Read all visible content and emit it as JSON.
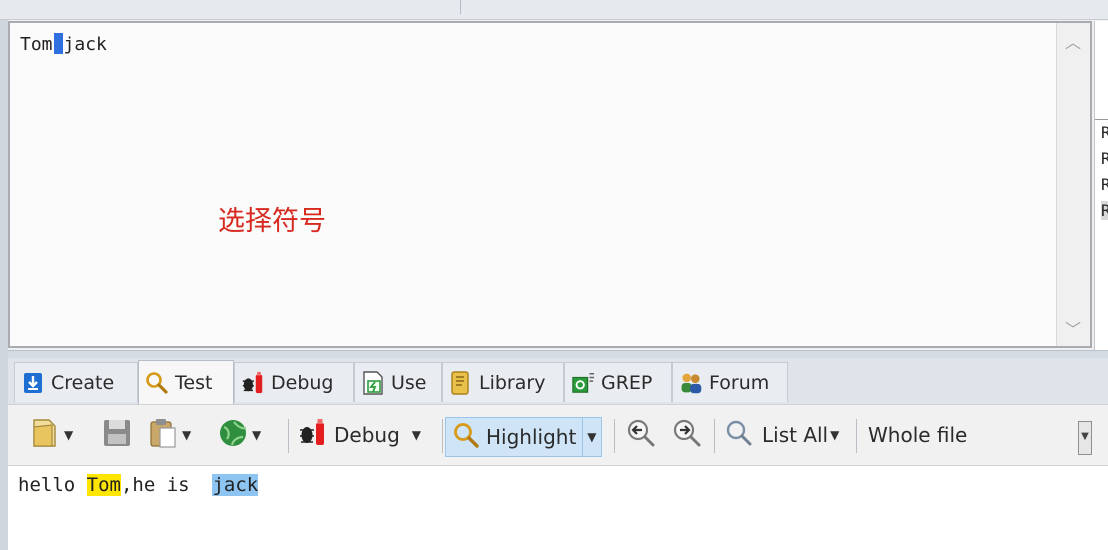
{
  "editor": {
    "regex_before": "Tom",
    "regex_after": "jack",
    "annotation": "选择符号",
    "scroll_up": "︿",
    "scroll_down": "﹀"
  },
  "right_panel": {
    "rows": [
      "R",
      "R",
      "R",
      "R"
    ]
  },
  "tabs": [
    {
      "label": "Create",
      "icon": "create-download-icon"
    },
    {
      "label": "Test",
      "icon": "magnifier-icon",
      "active": true
    },
    {
      "label": "Debug",
      "icon": "bug-icon"
    },
    {
      "label": "Use",
      "icon": "use-doc-icon"
    },
    {
      "label": "Library",
      "icon": "library-icon"
    },
    {
      "label": "GREP",
      "icon": "grep-icon"
    },
    {
      "label": "Forum",
      "icon": "forum-users-icon"
    }
  ],
  "toolbar": {
    "debug_label": "Debug",
    "highlight_label": "Highlight",
    "list_all_label": "List All",
    "scope_label": "Whole file"
  },
  "result": {
    "prefix": "hello ",
    "match1": "Tom",
    "middle": ",he is  ",
    "match2": "jack"
  },
  "colors": {
    "match_yellow": "#ffe600",
    "match_blue": "#8ec4f1",
    "annotation_red": "#d7291f",
    "caret_blue": "#2f6fe0"
  }
}
